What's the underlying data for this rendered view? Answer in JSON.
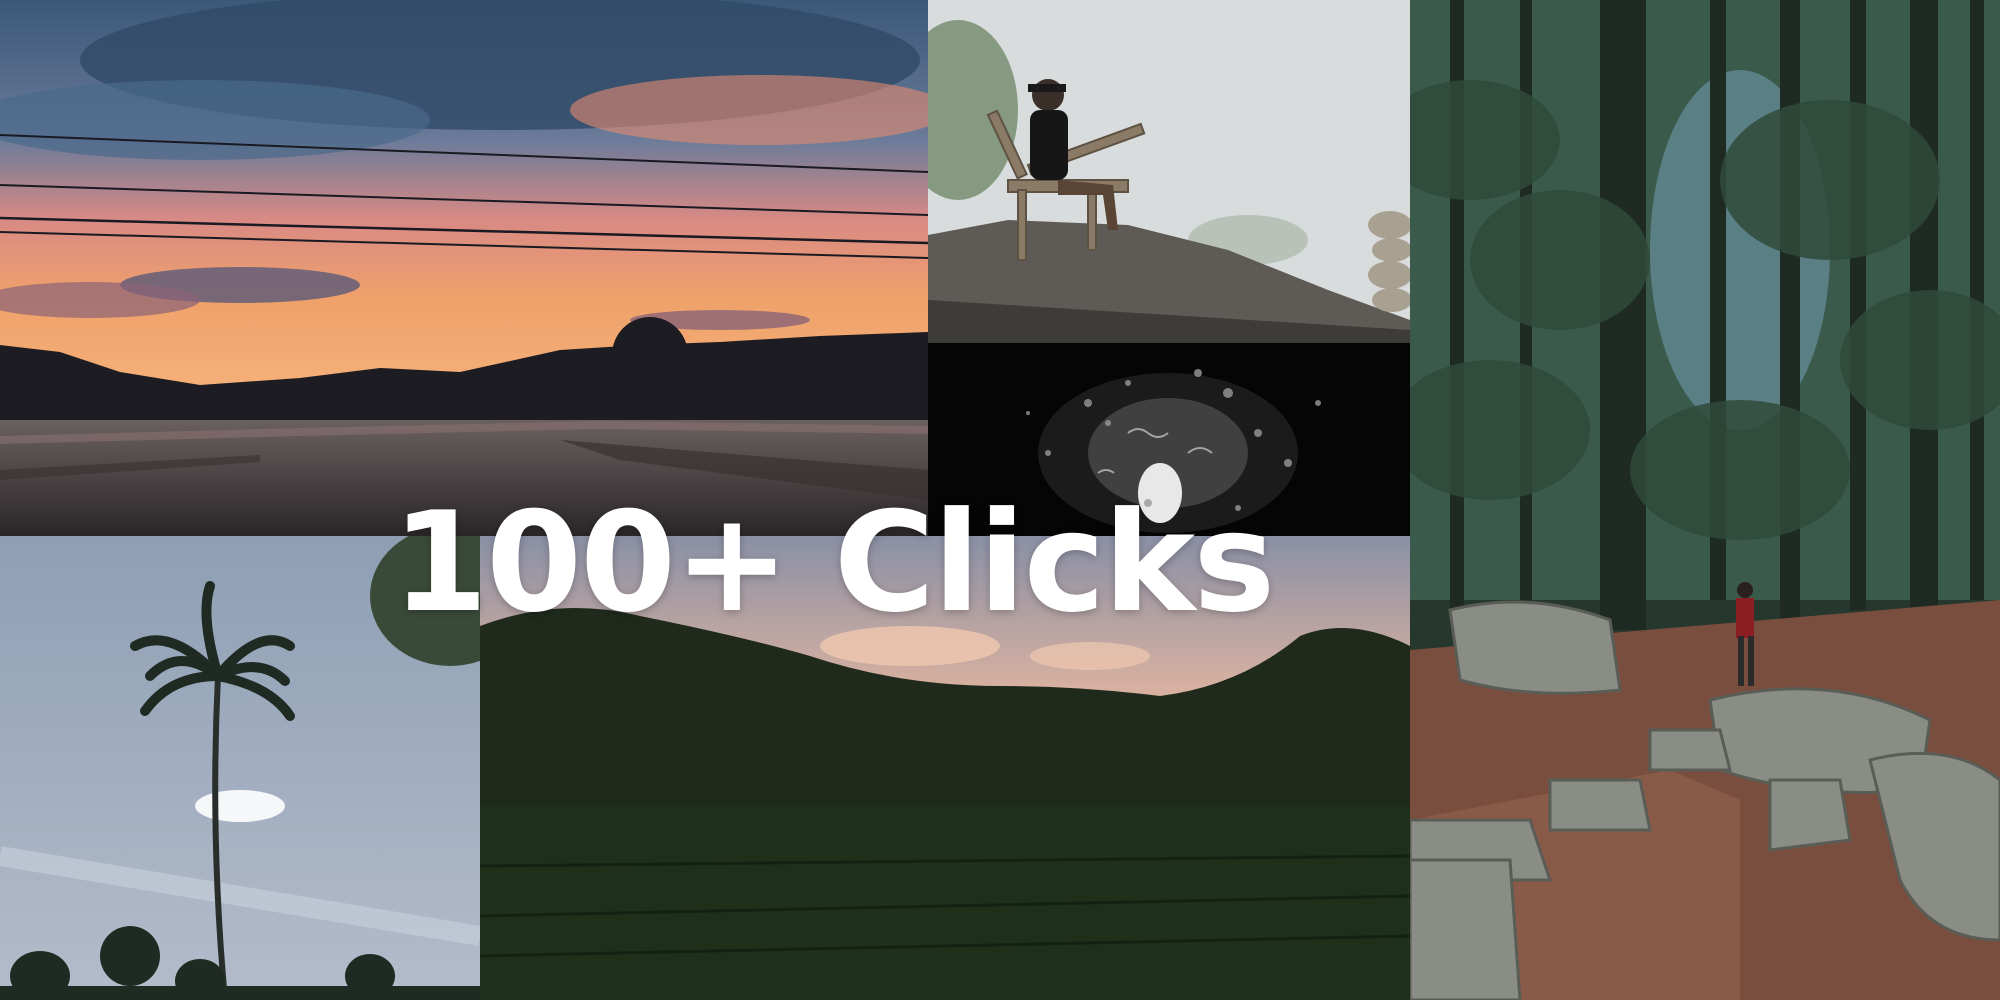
{
  "headline": "100+ Clicks",
  "photos": [
    {
      "subject": "sunset-over-river"
    },
    {
      "subject": "man-on-bench-in-fog"
    },
    {
      "subject": "raindrops-at-night"
    },
    {
      "subject": "pine-forest-trail"
    },
    {
      "subject": "palm-trees-sky"
    },
    {
      "subject": "field-at-dusk"
    }
  ],
  "colors": {
    "headline": "#ffffff"
  }
}
